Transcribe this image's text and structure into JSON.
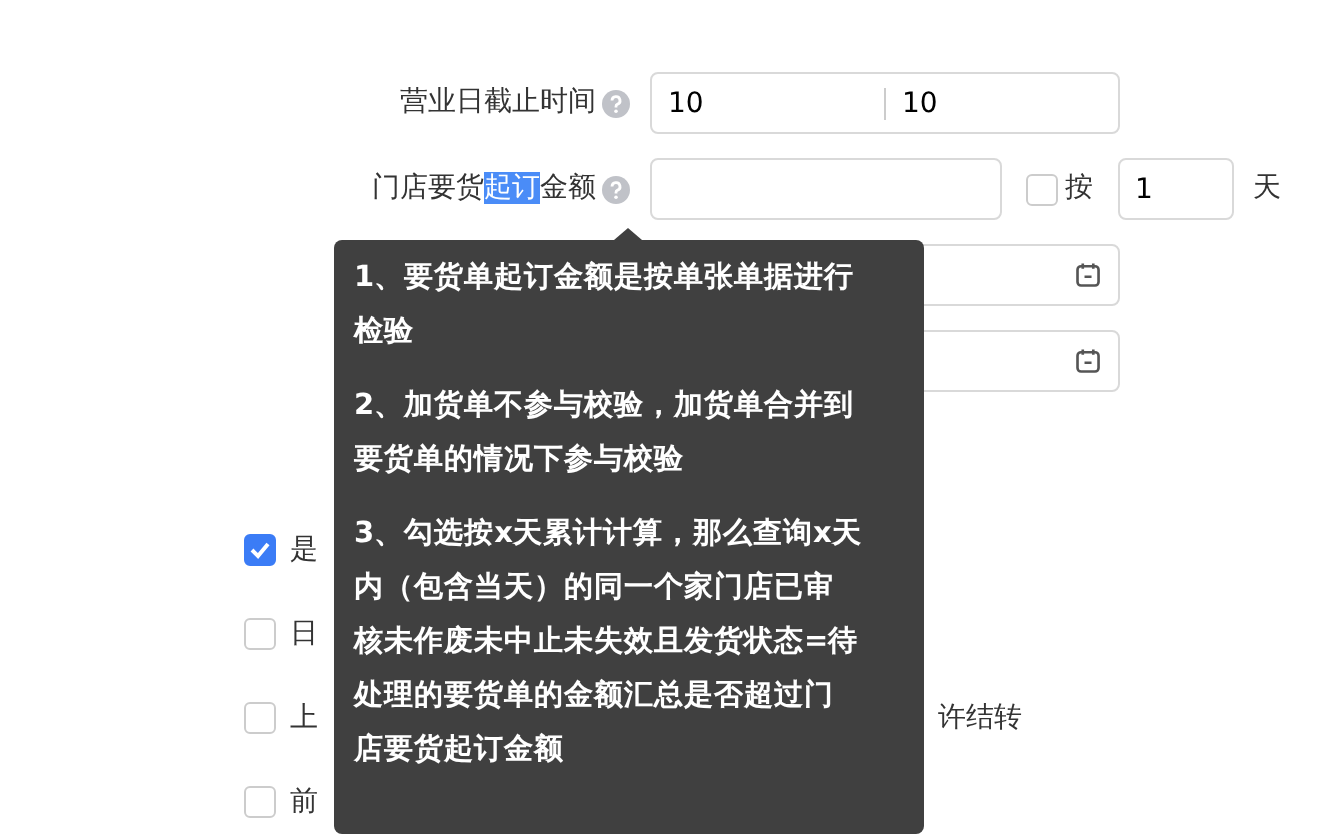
{
  "form_rows": [
    {
      "kind": "range",
      "label": [
        {
          "text": "营业日截止时间",
          "selected": false
        }
      ],
      "help": true,
      "values": [
        "10",
        "10"
      ]
    },
    {
      "kind": "amount",
      "label": [
        {
          "text": "门店要货",
          "selected": false
        },
        {
          "text": "起订",
          "selected": true
        },
        {
          "text": "金额",
          "selected": false
        }
      ],
      "help": true,
      "value": "",
      "accumulate": {
        "checked": false,
        "label": "按",
        "days": "1",
        "suffix": "天"
      }
    },
    {
      "kind": "date"
    },
    {
      "kind": "date"
    }
  ],
  "checkboxes": [
    {
      "label": "是",
      "checked": true
    },
    {
      "label": "日",
      "checked": false
    },
    {
      "label": "上",
      "label_end": "许结转",
      "checked": false
    },
    {
      "label": "前",
      "checked": false
    }
  ],
  "tooltip": {
    "paragraphs": [
      [
        "1、要货单起订金额是按单张单据进行",
        "检验"
      ],
      [
        "2、加货单不参与校验，加货单合并到",
        "要货单的情况下参与校验"
      ],
      [
        "3、勾选按x天累计计算，那么查询x天",
        "内（包含当天）的同一个家门店已审",
        "核未作废未中止未失效且发货状态=待",
        "处理的要货单的金额汇总是否超过门",
        "店要货起订金额"
      ]
    ]
  }
}
